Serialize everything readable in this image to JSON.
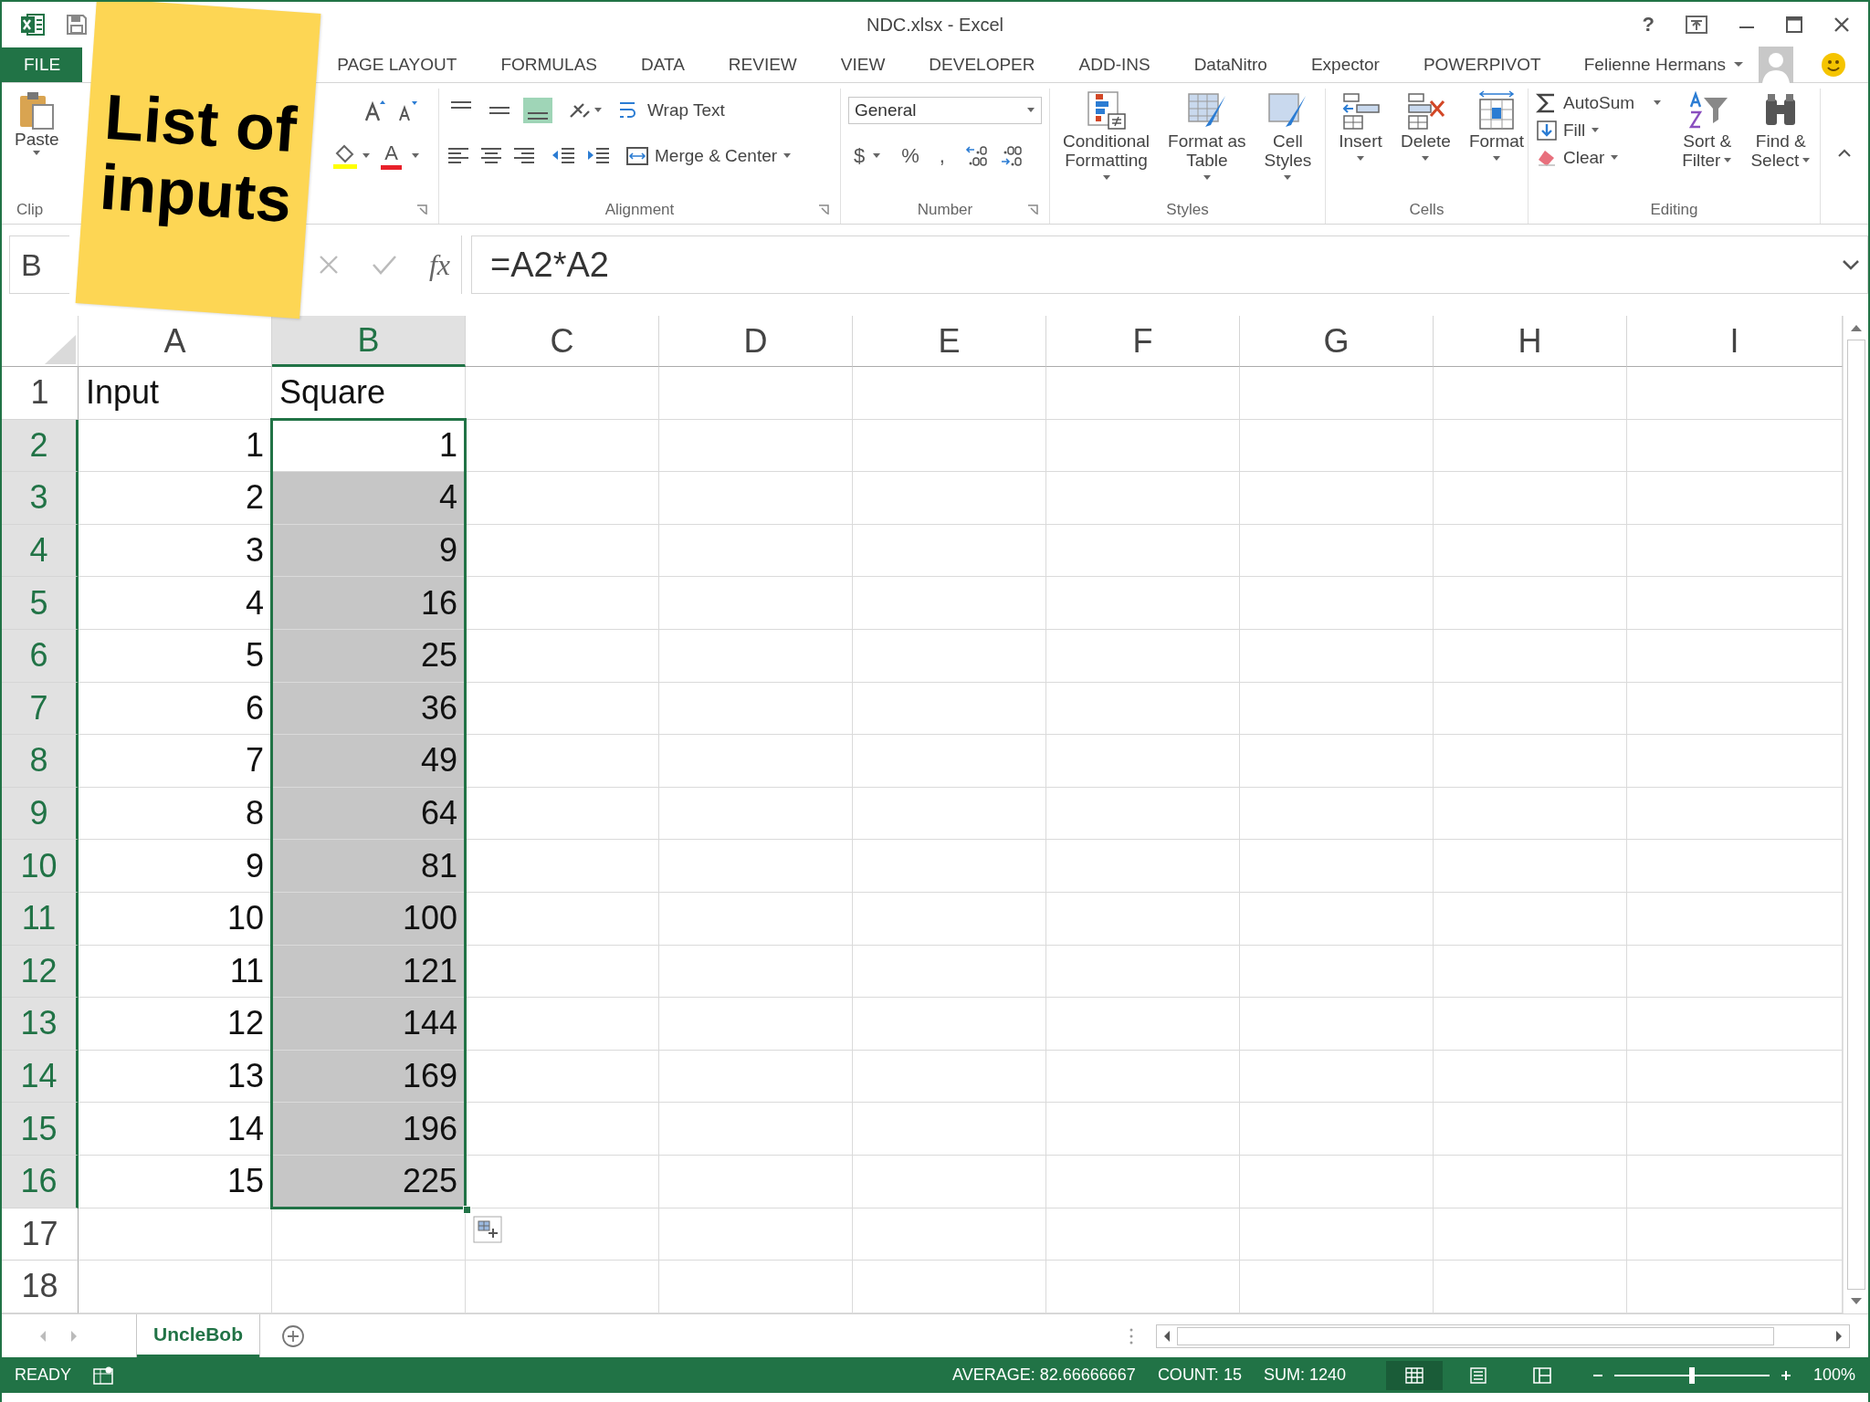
{
  "window": {
    "title": "NDC.xlsx - Excel",
    "help": "?",
    "user": "Felienne Hermans"
  },
  "menu_tabs": [
    {
      "label": "FILE",
      "kind": "file",
      "selected": false
    },
    {
      "label": "PAGE LAYOUT",
      "kind": "tab",
      "selected": false
    },
    {
      "label": "FORMULAS",
      "kind": "tab",
      "selected": false
    },
    {
      "label": "DATA",
      "kind": "tab",
      "selected": false
    },
    {
      "label": "REVIEW",
      "kind": "tab",
      "selected": false
    },
    {
      "label": "VIEW",
      "kind": "tab",
      "selected": false
    },
    {
      "label": "DEVELOPER",
      "kind": "tab",
      "selected": false
    },
    {
      "label": "ADD-INS",
      "kind": "tab",
      "selected": false
    },
    {
      "label": "DataNitro",
      "kind": "tab",
      "selected": false
    },
    {
      "label": "Expector",
      "kind": "tab",
      "selected": false
    },
    {
      "label": "POWERPIVOT",
      "kind": "tab",
      "selected": false
    }
  ],
  "ribbon": {
    "clipboard": {
      "label": "Clip",
      "paste": "Paste"
    },
    "font": {
      "color_glyph": "A"
    },
    "alignment": {
      "label": "Alignment",
      "wrap": "Wrap Text",
      "merge": "Merge & Center",
      "vertical": [
        {
          "kind": "top",
          "selected": false
        },
        {
          "kind": "middle",
          "selected": false
        },
        {
          "kind": "bottom",
          "selected": true
        }
      ]
    },
    "number": {
      "label": "Number",
      "format": "General",
      "currency": "$",
      "percent": "%",
      "comma": ","
    },
    "styles": {
      "label": "Styles",
      "buttons": [
        {
          "kind": "conditional",
          "lines": [
            "Conditional",
            "Formatting"
          ]
        },
        {
          "kind": "table",
          "lines": [
            "Format as",
            "Table"
          ]
        },
        {
          "kind": "cellstyles",
          "lines": [
            "Cell",
            "Styles"
          ]
        }
      ]
    },
    "cells": {
      "label": "Cells",
      "buttons": [
        {
          "kind": "insert",
          "label": "Insert"
        },
        {
          "kind": "delete",
          "label": "Delete"
        },
        {
          "kind": "format",
          "label": "Format"
        }
      ]
    },
    "editing": {
      "label": "Editing",
      "autosum": "AutoSum",
      "fill": "Fill",
      "clear": "Clear",
      "sort": [
        "Sort &",
        "Filter"
      ],
      "find": [
        "Find &",
        "Select"
      ]
    }
  },
  "formula_bar": {
    "name_box": "B",
    "fx": "fx",
    "formula": "=A2*A2"
  },
  "sheet": {
    "columns": [
      {
        "label": "A",
        "selected": false
      },
      {
        "label": "B",
        "selected": true
      },
      {
        "label": "C",
        "selected": false
      },
      {
        "label": "D",
        "selected": false
      },
      {
        "label": "E",
        "selected": false
      },
      {
        "label": "F",
        "selected": false
      },
      {
        "label": "G",
        "selected": false
      },
      {
        "label": "H",
        "selected": false
      },
      {
        "label": "I",
        "selected": false
      }
    ],
    "rows": [
      {
        "header": "1",
        "selected": false,
        "cells": [
          {
            "text": "Input",
            "kind": "text",
            "selected": false,
            "active": false
          },
          {
            "text": "Square",
            "kind": "text",
            "selected": false,
            "active": false
          }
        ]
      },
      {
        "header": "2",
        "selected": true,
        "cells": [
          {
            "text": "1",
            "kind": "number",
            "selected": false,
            "active": false
          },
          {
            "text": "1",
            "kind": "number",
            "selected": true,
            "active": true
          }
        ]
      },
      {
        "header": "3",
        "selected": true,
        "cells": [
          {
            "text": "2",
            "kind": "number",
            "selected": false,
            "active": false
          },
          {
            "text": "4",
            "kind": "number",
            "selected": true,
            "active": false
          }
        ]
      },
      {
        "header": "4",
        "selected": true,
        "cells": [
          {
            "text": "3",
            "kind": "number",
            "selected": false,
            "active": false
          },
          {
            "text": "9",
            "kind": "number",
            "selected": true,
            "active": false
          }
        ]
      },
      {
        "header": "5",
        "selected": true,
        "cells": [
          {
            "text": "4",
            "kind": "number",
            "selected": false,
            "active": false
          },
          {
            "text": "16",
            "kind": "number",
            "selected": true,
            "active": false
          }
        ]
      },
      {
        "header": "6",
        "selected": true,
        "cells": [
          {
            "text": "5",
            "kind": "number",
            "selected": false,
            "active": false
          },
          {
            "text": "25",
            "kind": "number",
            "selected": true,
            "active": false
          }
        ]
      },
      {
        "header": "7",
        "selected": true,
        "cells": [
          {
            "text": "6",
            "kind": "number",
            "selected": false,
            "active": false
          },
          {
            "text": "36",
            "kind": "number",
            "selected": true,
            "active": false
          }
        ]
      },
      {
        "header": "8",
        "selected": true,
        "cells": [
          {
            "text": "7",
            "kind": "number",
            "selected": false,
            "active": false
          },
          {
            "text": "49",
            "kind": "number",
            "selected": true,
            "active": false
          }
        ]
      },
      {
        "header": "9",
        "selected": true,
        "cells": [
          {
            "text": "8",
            "kind": "number",
            "selected": false,
            "active": false
          },
          {
            "text": "64",
            "kind": "number",
            "selected": true,
            "active": false
          }
        ]
      },
      {
        "header": "10",
        "selected": true,
        "cells": [
          {
            "text": "9",
            "kind": "number",
            "selected": false,
            "active": false
          },
          {
            "text": "81",
            "kind": "number",
            "selected": true,
            "active": false
          }
        ]
      },
      {
        "header": "11",
        "selected": true,
        "cells": [
          {
            "text": "10",
            "kind": "number",
            "selected": false,
            "active": false
          },
          {
            "text": "100",
            "kind": "number",
            "selected": true,
            "active": false
          }
        ]
      },
      {
        "header": "12",
        "selected": true,
        "cells": [
          {
            "text": "11",
            "kind": "number",
            "selected": false,
            "active": false
          },
          {
            "text": "121",
            "kind": "number",
            "selected": true,
            "active": false
          }
        ]
      },
      {
        "header": "13",
        "selected": true,
        "cells": [
          {
            "text": "12",
            "kind": "number",
            "selected": false,
            "active": false
          },
          {
            "text": "144",
            "kind": "number",
            "selected": true,
            "active": false
          }
        ]
      },
      {
        "header": "14",
        "selected": true,
        "cells": [
          {
            "text": "13",
            "kind": "number",
            "selected": false,
            "active": false
          },
          {
            "text": "169",
            "kind": "number",
            "selected": true,
            "active": false
          }
        ]
      },
      {
        "header": "15",
        "selected": true,
        "cells": [
          {
            "text": "14",
            "kind": "number",
            "selected": false,
            "active": false
          },
          {
            "text": "196",
            "kind": "number",
            "selected": true,
            "active": false
          }
        ]
      },
      {
        "header": "16",
        "selected": true,
        "cells": [
          {
            "text": "15",
            "kind": "number",
            "selected": false,
            "active": false
          },
          {
            "text": "225",
            "kind": "number",
            "selected": true,
            "active": false
          }
        ]
      },
      {
        "header": "17",
        "selected": false
      },
      {
        "header": "18",
        "selected": false
      }
    ]
  },
  "sheet_tabs": [
    {
      "label": "UncleBob",
      "selected": true
    }
  ],
  "status_bar": {
    "mode": "READY",
    "average": "AVERAGE: 82.66666667",
    "count": "COUNT: 15",
    "sum": "SUM: 1240",
    "views": [
      {
        "kind": "normal",
        "selected": true
      },
      {
        "kind": "page_layout",
        "selected": false
      },
      {
        "kind": "page_break",
        "selected": false
      }
    ],
    "zoom": {
      "level": 0.5,
      "reading": "100%"
    }
  },
  "note": {
    "text": "List of inputs"
  }
}
